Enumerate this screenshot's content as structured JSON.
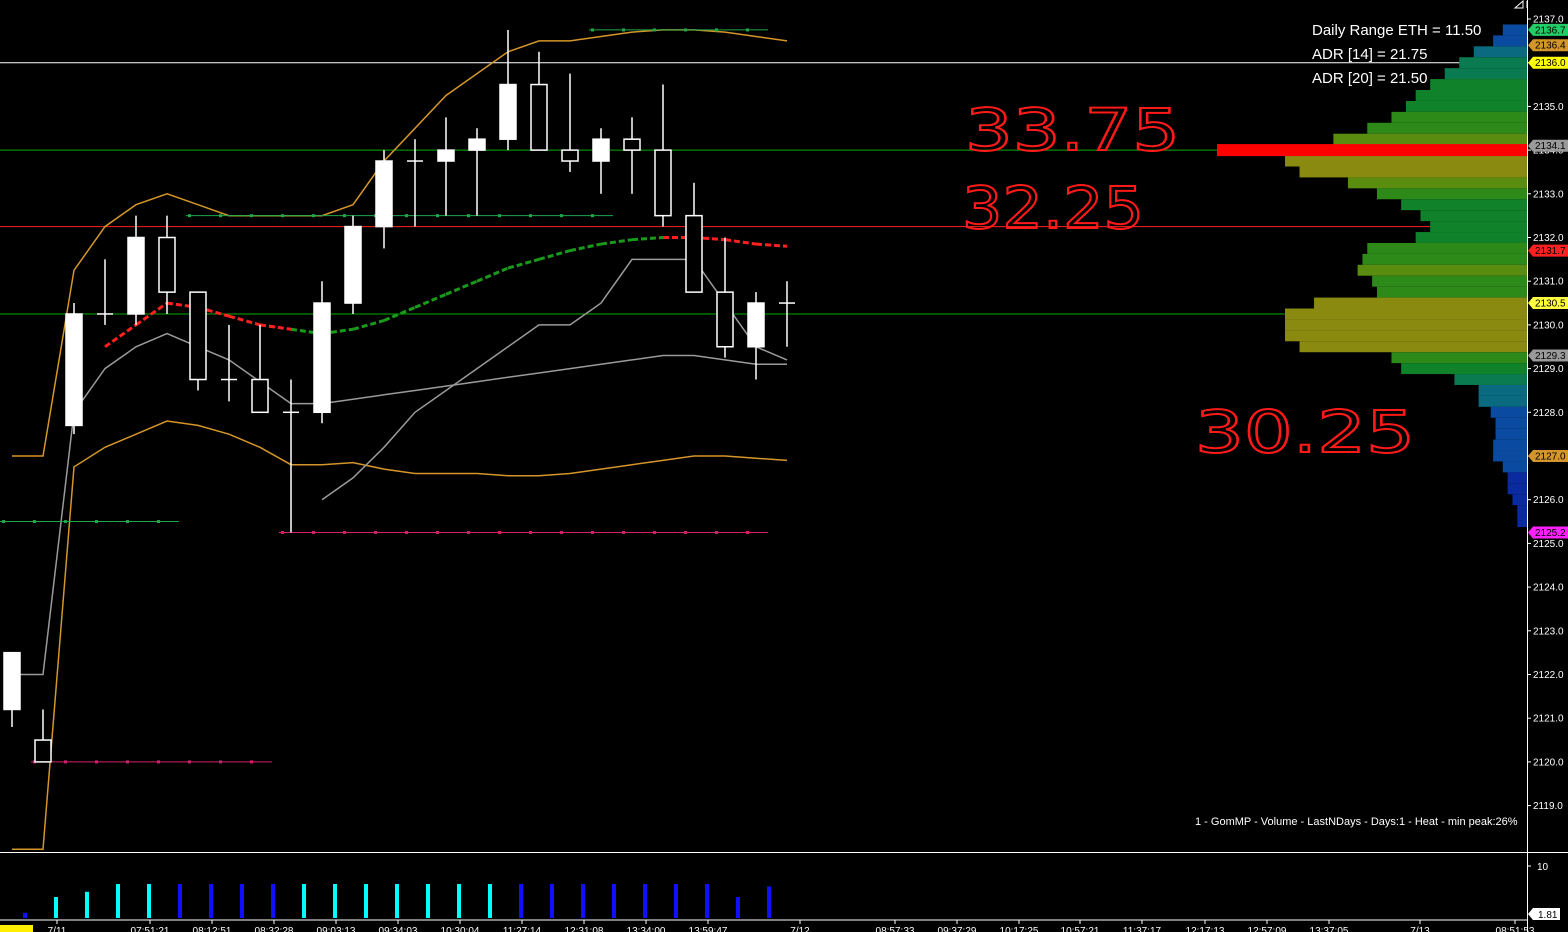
{
  "stats": {
    "daily_range": "Daily Range ETH = 11.50",
    "adr14": "ADR [14] = 21.75",
    "adr20": "ADR [20] = 21.50"
  },
  "handwritten": [
    "33.75",
    "32.25",
    "30.25"
  ],
  "profile_legend": "1 - GomMP  - Volume - LastNDays - Days:1 - Heat - min peak:26%",
  "volume_axis": {
    "top_label": "10",
    "last_value": "1.81"
  },
  "colors": {
    "background": "#000000",
    "candle": "#ffffff",
    "upper_band": "#d4962a",
    "middle_band": "#9a9a9a",
    "ema_up": "#1a9a1a",
    "ema_down": "#ff2020",
    "handwriting": "#ff1a1a",
    "volume_up": "#00ffff",
    "volume_down": "#1010ff"
  },
  "chart_data": {
    "type": "candlestick",
    "y_axis": {
      "min": 2118.5,
      "max": 2137.0,
      "ticks": [
        "2137.0",
        "2136.0",
        "2135.0",
        "2134.0",
        "2133.0",
        "2132.0",
        "2131.0",
        "2130.0",
        "2129.0",
        "2128.0",
        "2127.0",
        "2126.0",
        "2125.0",
        "2124.0",
        "2123.0",
        "2122.0",
        "2121.0",
        "2120.0",
        "2119.0"
      ]
    },
    "x_axis": {
      "tick_labels": [
        "7/11",
        "07:51:21",
        "08:12:51",
        "08:32:28",
        "09:03:13",
        "09:34:03",
        "10:30:04",
        "11:27:14",
        "12:31:08",
        "13:34:00",
        "13:59:47",
        "7/12",
        "08:57:33",
        "09:37:29",
        "10:17:25",
        "10:57:21",
        "11:37:17",
        "12:17:13",
        "12:57:09",
        "13:37:05",
        "7/13",
        "08:51:53"
      ]
    },
    "candles": [
      {
        "o": 2121.2,
        "h": 2122.5,
        "l": 2120.8,
        "c": 2122.5,
        "partial": true
      },
      {
        "o": 2120.5,
        "h": 2121.2,
        "l": 2120.5,
        "c": 2120.0
      },
      {
        "o": 2127.7,
        "h": 2130.5,
        "l": 2127.5,
        "c": 2130.25
      },
      {
        "o": 2130.25,
        "h": 2131.5,
        "l": 2130.0,
        "c": 2130.25
      },
      {
        "o": 2130.25,
        "h": 2132.5,
        "l": 2130.0,
        "c": 2132.0
      },
      {
        "o": 2132.0,
        "h": 2132.5,
        "l": 2130.25,
        "c": 2130.75
      },
      {
        "o": 2130.75,
        "h": 2130.75,
        "l": 2128.5,
        "c": 2128.75
      },
      {
        "o": 2128.75,
        "h": 2130.0,
        "l": 2128.25,
        "c": 2128.75
      },
      {
        "o": 2128.75,
        "h": 2130.0,
        "l": 2128.25,
        "c": 2128.0
      },
      {
        "o": 2128.0,
        "h": 2128.75,
        "l": 2125.25,
        "c": 2128.0
      },
      {
        "o": 2128.0,
        "h": 2131.0,
        "l": 2127.75,
        "c": 2130.5
      },
      {
        "o": 2130.5,
        "h": 2132.5,
        "l": 2130.25,
        "c": 2132.25
      },
      {
        "o": 2132.25,
        "h": 2134.0,
        "l": 2131.75,
        "c": 2133.75
      },
      {
        "o": 2133.75,
        "h": 2134.25,
        "l": 2132.25,
        "c": 2133.75
      },
      {
        "o": 2133.75,
        "h": 2134.75,
        "l": 2132.5,
        "c": 2134.0
      },
      {
        "o": 2134.0,
        "h": 2134.5,
        "l": 2132.5,
        "c": 2134.25
      },
      {
        "o": 2134.25,
        "h": 2136.75,
        "l": 2134.0,
        "c": 2135.5
      },
      {
        "o": 2135.5,
        "h": 2136.25,
        "l": 2134.0,
        "c": 2134.0
      },
      {
        "o": 2134.0,
        "h": 2135.75,
        "l": 2133.5,
        "c": 2133.75
      },
      {
        "o": 2133.75,
        "h": 2134.5,
        "l": 2133.0,
        "c": 2134.25
      },
      {
        "o": 2134.25,
        "h": 2134.75,
        "l": 2133.0,
        "c": 2134.0
      },
      {
        "o": 2134.0,
        "h": 2135.5,
        "l": 2132.25,
        "c": 2132.5
      },
      {
        "o": 2132.5,
        "h": 2133.25,
        "l": 2131.75,
        "c": 2130.75
      },
      {
        "o": 2130.75,
        "h": 2132.0,
        "l": 2129.25,
        "c": 2129.5
      },
      {
        "o": 2129.5,
        "h": 2130.75,
        "l": 2128.75,
        "c": 2130.5
      },
      {
        "o": 2130.5,
        "h": 2131.0,
        "l": 2129.5,
        "c": 2130.5
      }
    ],
    "upper_band": [
      2127.0,
      2127.0,
      2131.25,
      2132.25,
      2132.75,
      2133.0,
      2132.75,
      2132.5,
      2132.5,
      2132.5,
      2132.5,
      2132.75,
      2133.75,
      2134.5,
      2135.25,
      2135.75,
      2136.25,
      2136.5,
      2136.5,
      2136.6,
      2136.7,
      2136.75,
      2136.75,
      2136.7,
      2136.6,
      2136.5
    ],
    "middle_band": [
      2122.0,
      2122.0,
      2128.0,
      2129.0,
      2129.5,
      2129.8,
      2129.5,
      2129.2,
      2128.7,
      2128.2,
      2128.2,
      2128.3,
      2128.4,
      2128.5,
      2128.6,
      2128.7,
      2128.8,
      2128.9,
      2129.0,
      2129.1,
      2129.2,
      2129.3,
      2129.3,
      2129.2,
      2129.1,
      2129.1
    ],
    "lower_band": [
      2118.0,
      2118.0,
      2126.75,
      2127.2,
      2127.5,
      2127.8,
      2127.7,
      2127.5,
      2127.2,
      2126.8,
      2126.8,
      2126.85,
      2126.7,
      2126.6,
      2126.6,
      2126.6,
      2126.55,
      2126.55,
      2126.6,
      2126.7,
      2126.8,
      2126.9,
      2127.0,
      2127.0,
      2126.95,
      2126.9
    ],
    "upper_band_2": [
      null,
      null,
      null,
      null,
      null,
      null,
      null,
      null,
      null,
      null,
      2126.0,
      2126.5,
      2127.2,
      2128.0,
      2128.5,
      2129.0,
      2129.5,
      2130.0,
      2130.0,
      2130.5,
      2131.5,
      2131.5,
      2131.5,
      2130.5,
      2129.5,
      2129.2
    ],
    "ema": [
      null,
      null,
      null,
      2129.5,
      2130.0,
      2130.5,
      2130.4,
      2130.2,
      2130.0,
      2129.9,
      2129.8,
      2129.9,
      2130.1,
      2130.4,
      2130.7,
      2131.0,
      2131.3,
      2131.5,
      2131.7,
      2131.85,
      2131.95,
      2132.0,
      2132.0,
      2131.95,
      2131.85,
      2131.8
    ],
    "ema_trend": [
      "",
      "",
      "",
      "up",
      "down",
      "down",
      "down",
      "down",
      "down",
      "down",
      "up",
      "up",
      "up",
      "up",
      "up",
      "up",
      "up",
      "up",
      "up",
      "up",
      "up",
      "up",
      "down",
      "down",
      "down",
      "down"
    ],
    "volume": [
      0.3,
      1.2,
      1.5,
      2.0,
      3.0,
      3.3,
      3.0,
      3.0,
      3.0,
      3.0,
      2.6,
      3.0,
      4.0,
      4.4,
      4.7,
      5.0,
      5.0,
      5.0,
      5.0,
      4.6,
      4.2,
      3.0,
      2.0,
      1.2,
      1.81
    ],
    "volume_trend": [
      "down",
      "up",
      "up",
      "up",
      "up",
      "down",
      "down",
      "down",
      "down",
      "up",
      "up",
      "up",
      "up",
      "up",
      "up",
      "up",
      "down",
      "down",
      "down",
      "down",
      "down",
      "down",
      "down",
      "down",
      "down"
    ],
    "volume_ylim": [
      0,
      10
    ],
    "horizontal_lines": [
      {
        "price": 2136.0,
        "color": "#ffffff"
      },
      {
        "price": 2134.0,
        "color": "#00aa00"
      },
      {
        "price": 2132.25,
        "color": "#ff2020"
      },
      {
        "price": 2130.25,
        "color": "#00aa00"
      }
    ],
    "dotted_levels": [
      {
        "price": 2136.75,
        "from": 19,
        "to": 24,
        "color": "#1ea84a"
      },
      {
        "price": 2132.5,
        "from": 6,
        "to": 19,
        "color": "#1ea84a"
      },
      {
        "price": 2125.5,
        "from": -1,
        "to": 5,
        "color": "#1ea84a"
      },
      {
        "price": 2125.25,
        "from": 9,
        "to": 24,
        "color": "#d0206a"
      },
      {
        "price": 2120.0,
        "from": 1,
        "to": 8,
        "color": "#d0206a"
      }
    ],
    "axis_tags": [
      {
        "price": 2136.75,
        "label": "2136.7",
        "color": "#22cc66"
      },
      {
        "price": 2136.4,
        "label": "2136.4",
        "color": "#d4962a"
      },
      {
        "price": 2136.0,
        "label": "2136.0",
        "color": "#ffff00"
      },
      {
        "price": 2134.1,
        "label": "2134.1",
        "color": "#9a9a9a"
      },
      {
        "price": 2131.7,
        "label": "2131.7",
        "color": "#ff2020"
      },
      {
        "price": 2130.5,
        "label": "2130.5",
        "color": "#ffff40"
      },
      {
        "price": 2129.3,
        "label": "2129.3",
        "color": "#9a9a9a"
      },
      {
        "price": 2127.0,
        "label": "2127.0",
        "color": "#d4962a"
      },
      {
        "price": 2125.25,
        "label": "2125.2",
        "color": "#ff20ff"
      }
    ],
    "volume_profile": [
      {
        "price": 2136.75,
        "vol": 10
      },
      {
        "price": 2136.5,
        "vol": 14
      },
      {
        "price": 2136.25,
        "vol": 22
      },
      {
        "price": 2136.0,
        "vol": 28
      },
      {
        "price": 2135.75,
        "vol": 34
      },
      {
        "price": 2135.5,
        "vol": 40
      },
      {
        "price": 2135.25,
        "vol": 46
      },
      {
        "price": 2135.0,
        "vol": 50
      },
      {
        "price": 2134.75,
        "vol": 56
      },
      {
        "price": 2134.5,
        "vol": 66
      },
      {
        "price": 2134.25,
        "vol": 80
      },
      {
        "price": 2134.0,
        "vol": 100
      },
      {
        "price": 2133.75,
        "vol": 100
      },
      {
        "price": 2133.5,
        "vol": 94
      },
      {
        "price": 2133.25,
        "vol": 74
      },
      {
        "price": 2133.0,
        "vol": 62
      },
      {
        "price": 2132.75,
        "vol": 52
      },
      {
        "price": 2132.5,
        "vol": 44
      },
      {
        "price": 2132.25,
        "vol": 40
      },
      {
        "price": 2132.0,
        "vol": 46
      },
      {
        "price": 2131.75,
        "vol": 66
      },
      {
        "price": 2131.5,
        "vol": 68
      },
      {
        "price": 2131.25,
        "vol": 70
      },
      {
        "price": 2131.0,
        "vol": 64
      },
      {
        "price": 2130.75,
        "vol": 62
      },
      {
        "price": 2130.5,
        "vol": 88
      },
      {
        "price": 2130.25,
        "vol": 100
      },
      {
        "price": 2130.0,
        "vol": 100
      },
      {
        "price": 2129.75,
        "vol": 100
      },
      {
        "price": 2129.5,
        "vol": 94
      },
      {
        "price": 2129.25,
        "vol": 56
      },
      {
        "price": 2129.0,
        "vol": 52
      },
      {
        "price": 2128.75,
        "vol": 30
      },
      {
        "price": 2128.5,
        "vol": 20
      },
      {
        "price": 2128.25,
        "vol": 20
      },
      {
        "price": 2128.0,
        "vol": 15
      },
      {
        "price": 2127.75,
        "vol": 13
      },
      {
        "price": 2127.5,
        "vol": 13
      },
      {
        "price": 2127.25,
        "vol": 14
      },
      {
        "price": 2127.0,
        "vol": 14
      },
      {
        "price": 2126.75,
        "vol": 10
      },
      {
        "price": 2126.5,
        "vol": 8
      },
      {
        "price": 2126.25,
        "vol": 8
      },
      {
        "price": 2126.0,
        "vol": 6
      },
      {
        "price": 2125.75,
        "vol": 4
      },
      {
        "price": 2125.5,
        "vol": 4
      }
    ],
    "poc_price": 2134.0
  }
}
